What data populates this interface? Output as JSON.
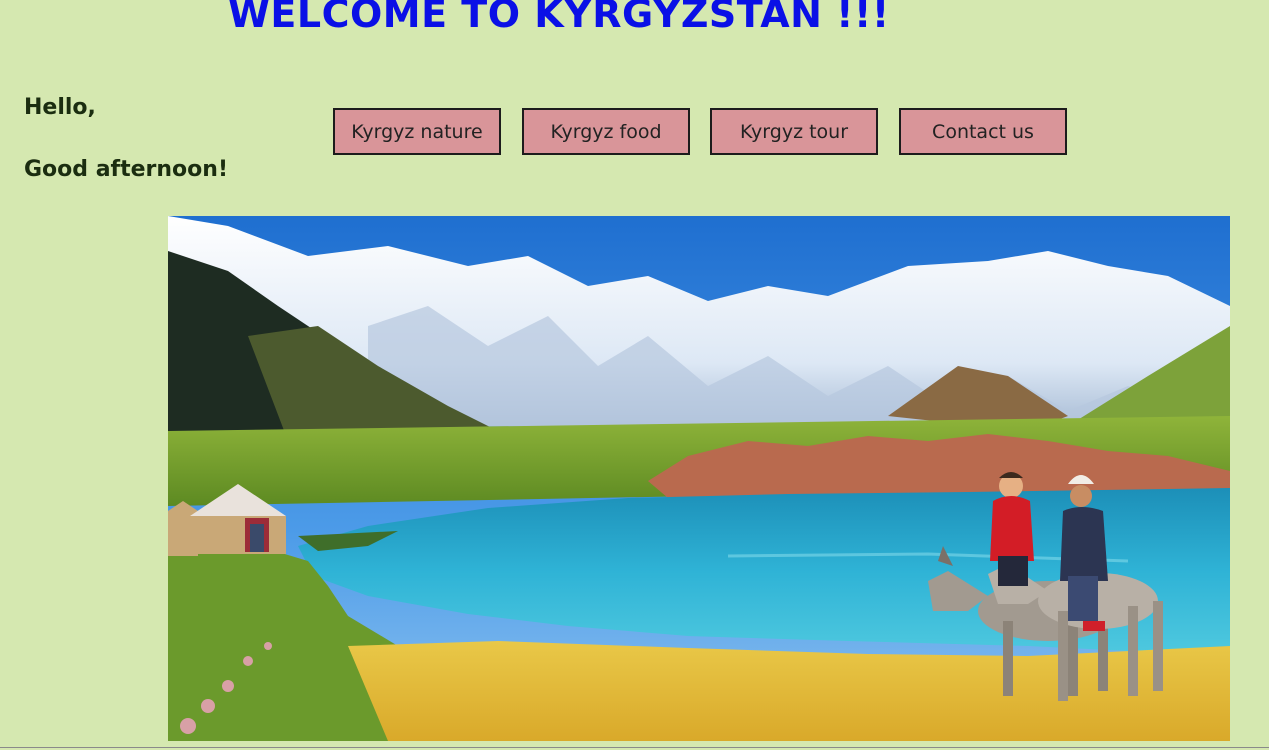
{
  "page": {
    "title": "WELCOME TO KYRGYZSTAN !!!",
    "greeting_line1": "Hello,",
    "greeting_line2": "Good afternoon!"
  },
  "nav": {
    "items": [
      {
        "label": "Kyrgyz nature"
      },
      {
        "label": "Kyrgyz food"
      },
      {
        "label": "Kyrgyz tour"
      },
      {
        "label": "Contact us"
      }
    ]
  },
  "colors": {
    "background": "#d5e8b0",
    "title": "#0a10e6",
    "button_bg": "#d99599",
    "button_border": "#1c1c1c"
  },
  "hero_image": {
    "subject": "Kyrgyz landscape: snowy mountains, turquoise lake, yurt, children on donkeys"
  }
}
